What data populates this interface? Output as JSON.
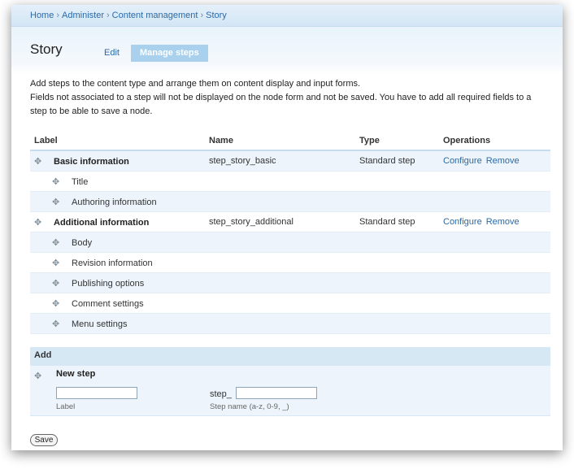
{
  "breadcrumb": [
    "Home",
    "Administer",
    "Content management",
    "Story"
  ],
  "breadcrumb_separator": "›",
  "page_title": "Story",
  "tabs": [
    {
      "label": "Edit",
      "active": false
    },
    {
      "label": "Manage steps",
      "active": true
    }
  ],
  "help": {
    "line1": "Add steps to the content type and arrange them on content display and input forms.",
    "line2": "Fields not associated to a step will not be displayed on the node form and not be saved. You have to add all required fields to a step to be able to save a node."
  },
  "table": {
    "headers": {
      "label": "Label",
      "name": "Name",
      "type": "Type",
      "operations": "Operations"
    },
    "steps": [
      {
        "label": "Basic information",
        "name": "step_story_basic",
        "type": "Standard step",
        "configure": "Configure",
        "remove": "Remove",
        "fields": [
          "Title",
          "Authoring information"
        ]
      },
      {
        "label": "Additional information",
        "name": "step_story_additional",
        "type": "Standard step",
        "configure": "Configure",
        "remove": "Remove",
        "fields": [
          "Body",
          "Revision information",
          "Publishing options",
          "Comment settings",
          "Menu settings"
        ]
      }
    ]
  },
  "add": {
    "header": "Add",
    "new_step_title": "New step",
    "label_value": "",
    "label_description": "Label",
    "name_prefix": "step_",
    "name_value": "",
    "name_description": "Step name (a-z, 0-9, _)"
  },
  "save_label": "Save",
  "icons": {
    "drag": "drag-handle-icon"
  },
  "colors": {
    "link": "#2a6aa8",
    "active_tab": "#a9d0ec",
    "row_alt": "#edf4fb"
  }
}
